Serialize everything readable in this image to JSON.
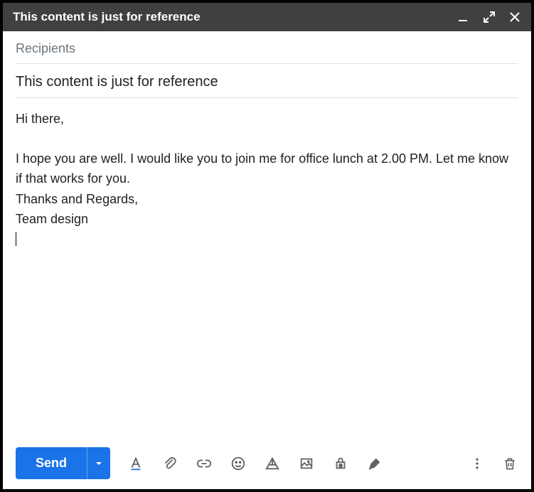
{
  "titleBar": {
    "title": "This content is just for reference"
  },
  "fields": {
    "recipientsPlaceholder": "Recipients",
    "subject": "This content is just for reference"
  },
  "body": {
    "greeting": "Hi there,",
    "paragraph": "I hope you are well. I would like you to join me for office lunch at 2.00 PM. Let me know if that works for you.",
    "signOff1": "Thanks and Regards,",
    "signOff2": "Team design"
  },
  "toolbar": {
    "sendLabel": "Send"
  }
}
